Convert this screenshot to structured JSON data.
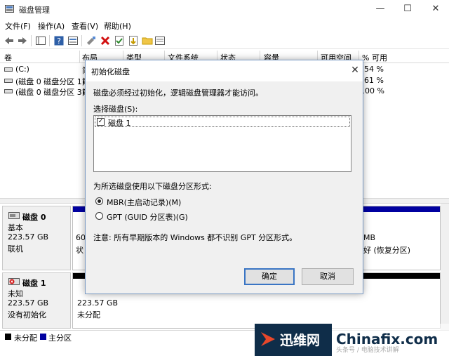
{
  "window": {
    "title": "磁盘管理",
    "controls": {
      "minimize": "—",
      "maximize": "☐",
      "close": "✕"
    }
  },
  "menu": [
    "文件(F)",
    "操作(A)",
    "查看(V)",
    "帮助(H)"
  ],
  "volume_list": {
    "headers": [
      "卷",
      "布局",
      "类型",
      "文件系统",
      "状态",
      "容量",
      "可用空间",
      "% 可用"
    ],
    "rows": [
      {
        "name": "(C:)",
        "layout": "简",
        "free_pct": "54 %"
      },
      {
        "name": "(磁盘 0 磁盘分区 1)",
        "layout": "简",
        "free_pct": "61 %"
      },
      {
        "name": "(磁盘 0 磁盘分区 3)",
        "layout": "简",
        "free_pct": "100 %"
      }
    ]
  },
  "disks": [
    {
      "name": "磁盘 0",
      "type": "基本",
      "size": "223.57 GB",
      "status": "联机",
      "partition_left": {
        "line1": "60",
        "line2": "状"
      },
      "partition_right": {
        "line1": "MB",
        "line2": "好 (恢复分区)"
      }
    },
    {
      "name": "磁盘 1",
      "type": "未知",
      "size": "223.57 GB",
      "status": "没有初始化",
      "partition": {
        "line1": "223.57 GB",
        "line2": "未分配"
      }
    }
  ],
  "legend": [
    {
      "label": "未分配",
      "color": "#000000"
    },
    {
      "label": "主分区",
      "color": "#0000a0"
    }
  ],
  "dialog": {
    "title": "初始化磁盘",
    "message": "磁盘必须经过初始化，逻辑磁盘管理器才能访问。",
    "select_label": "选择磁盘(S):",
    "disk_item": "磁盘 1",
    "disk_item_checked": true,
    "style_label": "为所选磁盘使用以下磁盘分区形式:",
    "options": [
      "MBR(主启动记录)(M)",
      "GPT (GUID 分区表)(G)"
    ],
    "selected_option": 0,
    "note": "注意: 所有早期版本的 Windows 都不识别 GPT 分区形式。",
    "ok": "确定",
    "cancel": "取消"
  },
  "watermark": {
    "brand": "迅维网",
    "site": "Chinafix.com",
    "sub": "头条号 / 电脑技术讲解"
  },
  "colors": {
    "primary_partition": "#0000a0",
    "unallocated": "#000000",
    "accent": "#3a75c4",
    "watermark_bg": "#0f2d49"
  }
}
